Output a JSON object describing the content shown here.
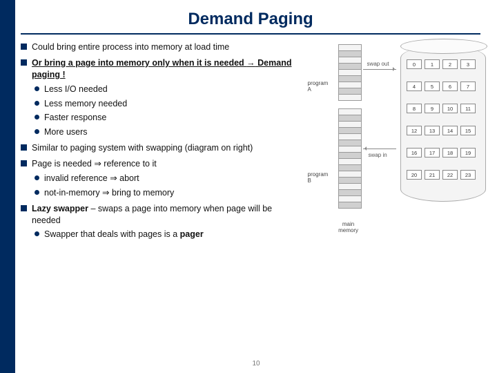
{
  "title": "Demand Paging",
  "page_number": "10",
  "bullets": {
    "b1": "Could bring entire process into memory at load time",
    "b2a": "Or bring a page into memory only when it is needed ",
    "b2_arrow": "→",
    "b2b": " Demand paging !",
    "b2_s1": "Less I/O needed",
    "b2_s2": "Less memory needed",
    "b2_s3": "Faster response",
    "b2_s4": "More users",
    "b3": "Similar to paging system with swapping (diagram on right)",
    "b4": "Page is needed ⇒ reference to it",
    "b4_s1": "invalid reference ⇒ abort",
    "b4_s2": "not-in-memory ⇒ bring to memory",
    "b5a": "Lazy swapper",
    "b5b": " – swaps a page into memory when page will be needed",
    "b5_s1a": "Swapper that deals with pages is a ",
    "b5_s1b": "pager"
  },
  "diagram": {
    "programA": "program\nA",
    "programB": "program\nB",
    "main_memory": "main\nmemory",
    "swap_out": "swap out",
    "swap_in": "swap in",
    "pages": [
      "0",
      "1",
      "2",
      "3",
      "4",
      "5",
      "6",
      "7",
      "8",
      "9",
      "10",
      "11",
      "12",
      "13",
      "14",
      "15",
      "16",
      "17",
      "18",
      "19",
      "20",
      "21",
      "22",
      "23"
    ]
  }
}
